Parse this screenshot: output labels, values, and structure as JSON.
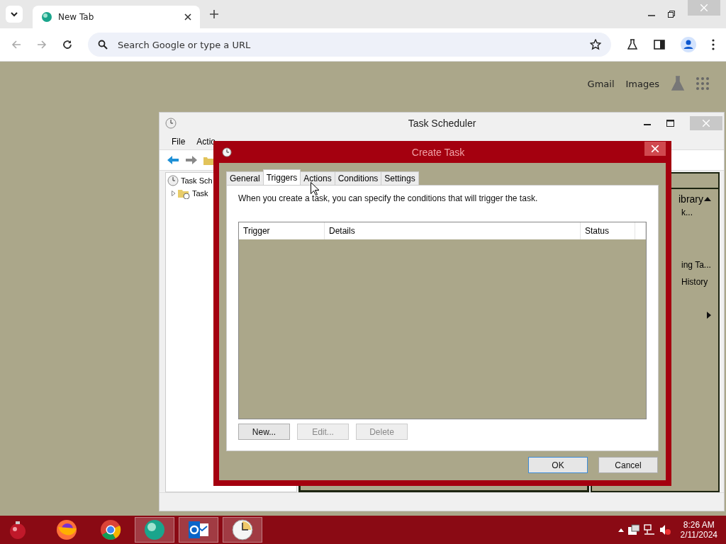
{
  "browser": {
    "tab_title": "New Tab",
    "address_placeholder": "Search Google or type a URL",
    "links": [
      "Gmail",
      "Images"
    ]
  },
  "scheduler": {
    "title": "Task Scheduler",
    "menu": [
      "File",
      "Actio"
    ],
    "tree": [
      {
        "label": "Task Sch",
        "children": [
          {
            "label": "Task",
            "expanded": false
          }
        ]
      }
    ],
    "actions_pane": [
      "ibrary",
      "k...",
      "ing Ta...",
      "History"
    ]
  },
  "dialog": {
    "title": "Create Task",
    "tabs": [
      {
        "label": "General",
        "selected": false
      },
      {
        "label": "Triggers",
        "selected": true
      },
      {
        "label": "Actions",
        "selected": false
      },
      {
        "label": "Conditions",
        "selected": false
      },
      {
        "label": "Settings",
        "selected": false
      }
    ],
    "description": "When you create a task, you can specify the conditions that will trigger the task.",
    "table": {
      "columns": [
        "Trigger",
        "Details",
        "Status"
      ]
    },
    "list_buttons": [
      {
        "label": "New...",
        "disabled": false
      },
      {
        "label": "Edit...",
        "disabled": true
      },
      {
        "label": "Delete",
        "disabled": true
      }
    ],
    "buttons": [
      {
        "label": "OK",
        "default": true
      },
      {
        "label": "Cancel",
        "default": false
      }
    ]
  },
  "taskbar": {
    "apps": [
      {
        "kind": "firefox",
        "active": false
      },
      {
        "kind": "chrome",
        "active": false
      },
      {
        "kind": "edge",
        "active": true
      },
      {
        "kind": "outlook",
        "active": true
      },
      {
        "kind": "clock",
        "active": true
      }
    ],
    "time": "8:26 AM",
    "date": "2/11/2024"
  }
}
